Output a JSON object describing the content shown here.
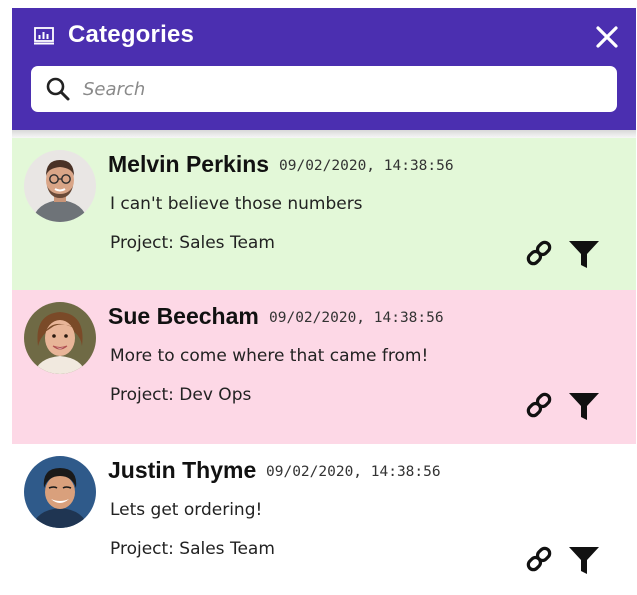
{
  "header": {
    "title": "Categories",
    "icon": "chart-icon",
    "background": "#4b2fb0",
    "close_icon": "close-icon"
  },
  "search": {
    "placeholder": "Search",
    "value": ""
  },
  "comments": [
    {
      "name": "Melvin Perkins",
      "timestamp": "09/02/2020, 14:38:56",
      "message": "I can't believe those numbers",
      "project": "Project: Sales Team",
      "background": "#e3f8d8"
    },
    {
      "name": "Sue Beecham",
      "timestamp": "09/02/2020, 14:38:56",
      "message": "More to come where that came from!",
      "project": "Project: Dev Ops",
      "background": "#fdd8e6"
    },
    {
      "name": "Justin Thyme",
      "timestamp": "09/02/2020, 14:38:56",
      "message": "Lets get ordering!",
      "project": "Project: Sales Team",
      "background": "#ffffff"
    }
  ]
}
